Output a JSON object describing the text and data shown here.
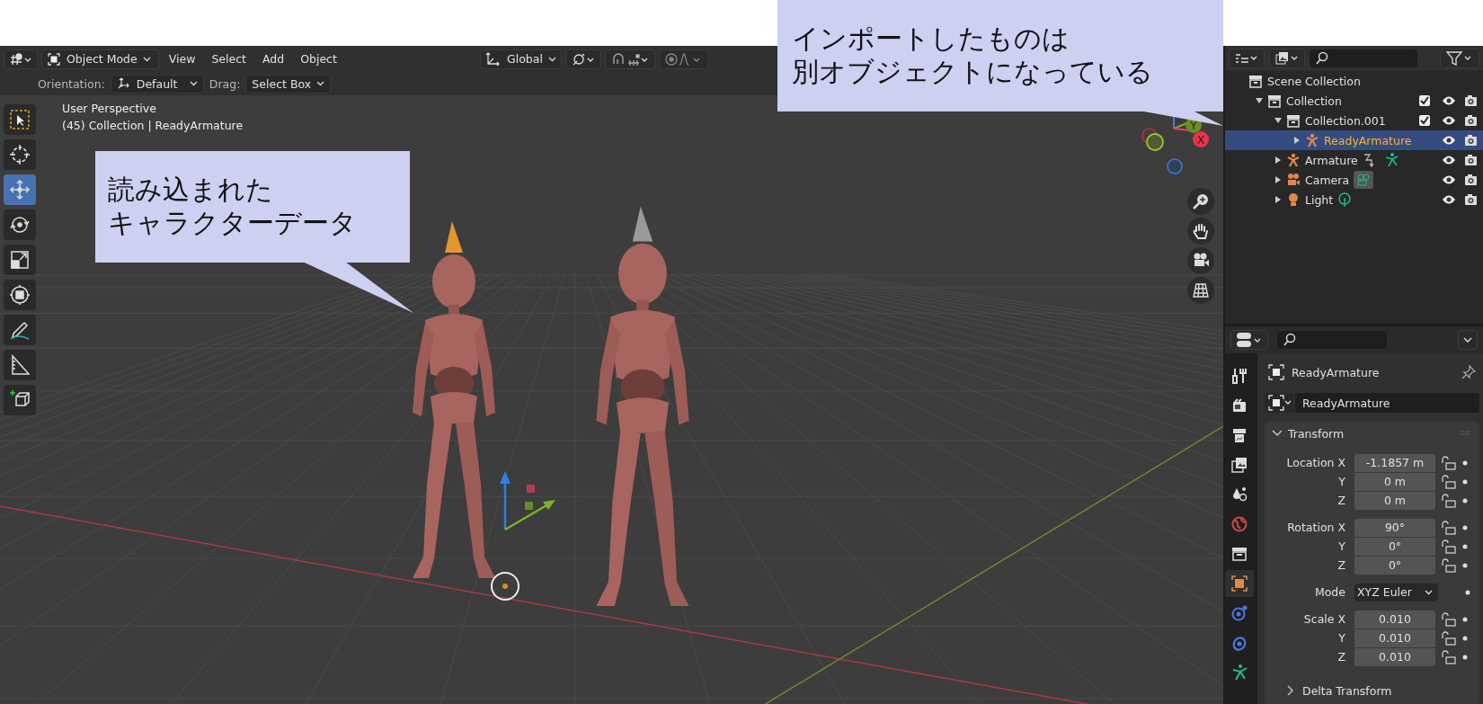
{
  "callouts": [
    {
      "lines": [
        "読み込まれた",
        "キャラクターデータ"
      ]
    },
    {
      "lines": [
        "インポートしたものは",
        "別オブジェクトになっている"
      ]
    }
  ],
  "header": {
    "mode": "Object Mode",
    "menus": [
      "View",
      "Select",
      "Add",
      "Object"
    ],
    "orientation": "Global"
  },
  "tool_settings": {
    "orientation_label": "Orientation:",
    "orientation": "Default",
    "drag_label": "Drag:",
    "drag": "Select Box"
  },
  "viewport": {
    "perspective": "User Perspective",
    "context": "(45) Collection | ReadyArmature",
    "gizmo_x": "X",
    "gizmo_y": "Y"
  },
  "toolbar": [
    {
      "kind": "select",
      "selected": false
    },
    {
      "kind": "cursor",
      "selected": false
    },
    {
      "kind": "move",
      "selected": true
    },
    {
      "kind": "rotate",
      "selected": false
    },
    {
      "kind": "scale",
      "selected": false
    },
    {
      "kind": "transform",
      "selected": false
    },
    {
      "kind": "annotate",
      "selected": false
    },
    {
      "kind": "measure",
      "selected": false
    },
    {
      "kind": "add",
      "selected": false
    }
  ],
  "outliner": {
    "items": [
      {
        "label": "Scene Collection",
        "kind": "scene",
        "children": [
          {
            "label": "Collection",
            "kind": "collection",
            "expanded": true,
            "checked": true,
            "children": [
              {
                "label": "Collection.001",
                "kind": "collection",
                "expanded": true,
                "checked": true,
                "children": [
                  {
                    "label": "ReadyArmature",
                    "kind": "armature",
                    "expanded": false,
                    "selected": true,
                    "data_icons": false
                  }
                ]
              },
              {
                "label": "Armature",
                "kind": "armature",
                "expanded": false,
                "selected": false,
                "data_icons": true
              },
              {
                "label": "Camera",
                "kind": "camera",
                "expanded": false,
                "selected": false,
                "data_icons": true
              },
              {
                "label": "Light",
                "kind": "light",
                "expanded": false,
                "selected": false,
                "data_icons": true
              }
            ]
          }
        ]
      }
    ]
  },
  "properties": {
    "tabs": [
      {
        "kind": "tool",
        "selected": false
      },
      {
        "kind": "render",
        "selected": false
      },
      {
        "kind": "output",
        "selected": false
      },
      {
        "kind": "view_layer",
        "selected": false
      },
      {
        "kind": "scene",
        "selected": false
      },
      {
        "kind": "world",
        "selected": false
      },
      {
        "kind": "collection",
        "selected": false
      },
      {
        "kind": "object",
        "selected": true
      },
      {
        "kind": "physics",
        "selected": false
      },
      {
        "kind": "constraints",
        "selected": false
      },
      {
        "kind": "data",
        "selected": false
      }
    ],
    "object_name": "ReadyArmature",
    "datablock": "ReadyArmature",
    "panel": {
      "title": "Transform",
      "expanded": true,
      "groups": [
        [
          {
            "label": "Location X",
            "value": "-1.1857 m",
            "kind": "number"
          },
          {
            "label": "Y",
            "value": "0 m",
            "kind": "number"
          },
          {
            "label": "Z",
            "value": "0 m",
            "kind": "number"
          }
        ],
        [
          {
            "label": "Rotation X",
            "value": "90°",
            "kind": "number"
          },
          {
            "label": "Y",
            "value": "0°",
            "kind": "number"
          },
          {
            "label": "Z",
            "value": "0°",
            "kind": "number"
          }
        ],
        [
          {
            "label": "Mode",
            "value": "XYZ Euler",
            "kind": "dropdown"
          }
        ],
        [
          {
            "label": "Scale X",
            "value": "0.010",
            "kind": "number"
          },
          {
            "label": "Y",
            "value": "0.010",
            "kind": "number"
          },
          {
            "label": "Z",
            "value": "0.010",
            "kind": "number"
          }
        ]
      ]
    },
    "subpanel": {
      "title": "Delta Transform",
      "expanded": false
    }
  }
}
